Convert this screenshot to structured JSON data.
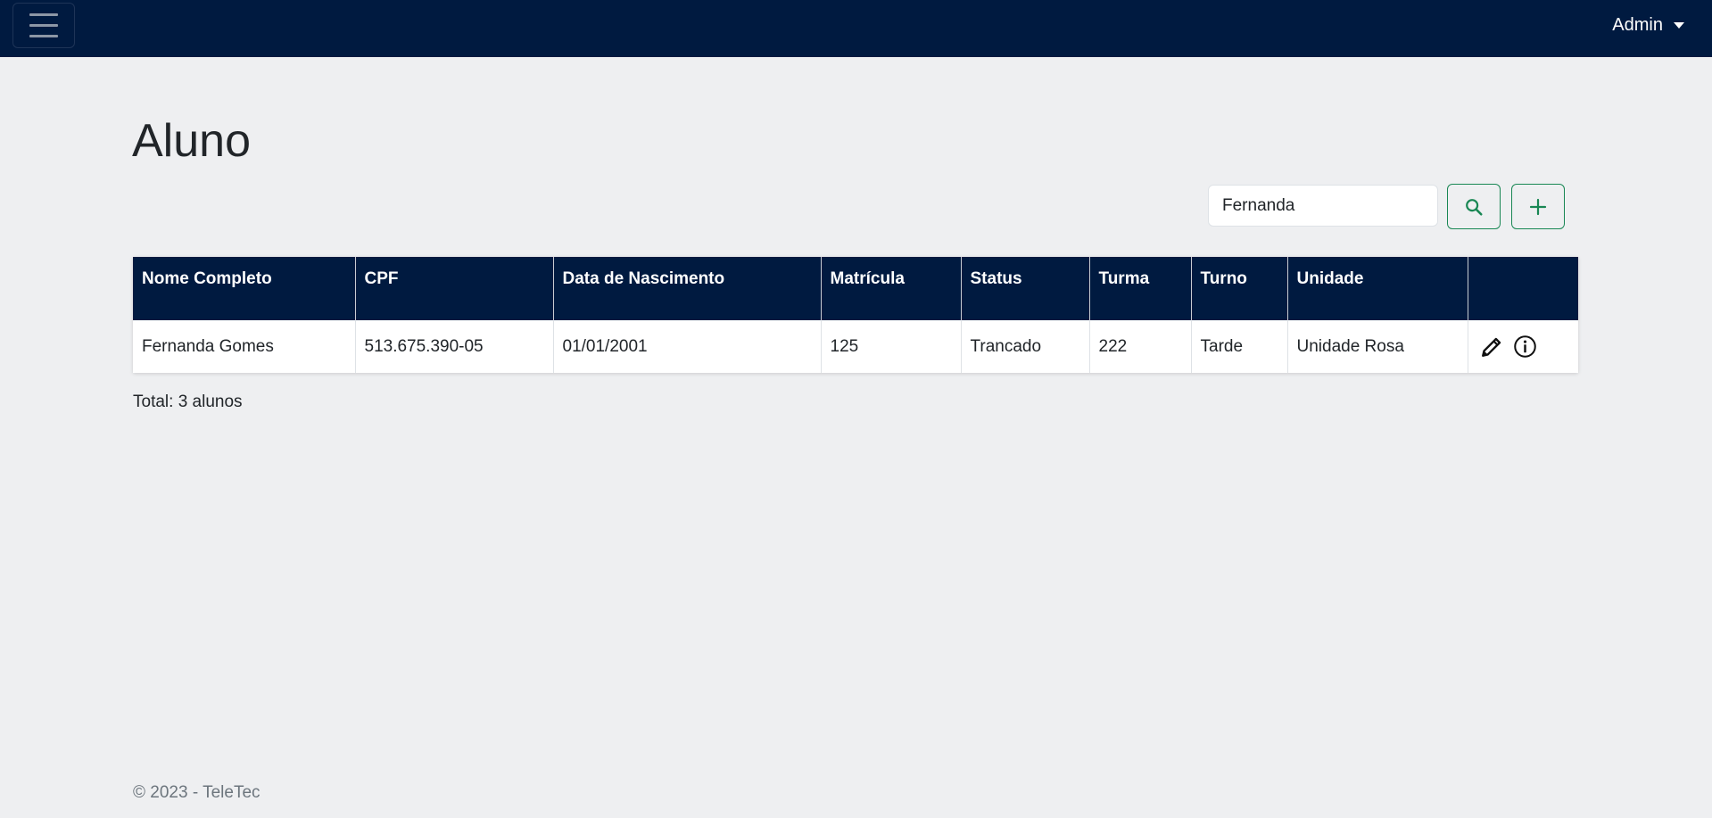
{
  "navbar": {
    "user_menu_label": "Admin"
  },
  "page": {
    "title": "Aluno"
  },
  "search": {
    "value": "Fernanda",
    "placeholder": ""
  },
  "colors": {
    "navbar_bg": "#001a40",
    "accent_green": "#198754",
    "page_bg": "#eeeff1"
  },
  "table": {
    "headers": [
      "Nome Completo",
      "CPF",
      "Data de Nascimento",
      "Matrícula",
      "Status",
      "Turma",
      "Turno",
      "Unidade",
      ""
    ],
    "rows": [
      {
        "nome": "Fernanda Gomes",
        "cpf": "513.675.390-05",
        "nascimento": "01/01/2001",
        "matricula": "125",
        "status": "Trancado",
        "turma": "222",
        "turno": "Tarde",
        "unidade": "Unidade Rosa"
      }
    ]
  },
  "summary": {
    "total_text": "Total: 3 alunos"
  },
  "footer": {
    "text": "© 2023 - TeleTec"
  },
  "icons": {
    "menu": "hamburger-icon",
    "user_caret": "caret-down-icon",
    "search": "search-icon",
    "add": "plus-icon",
    "edit": "pencil-icon",
    "info": "info-circle-icon"
  }
}
